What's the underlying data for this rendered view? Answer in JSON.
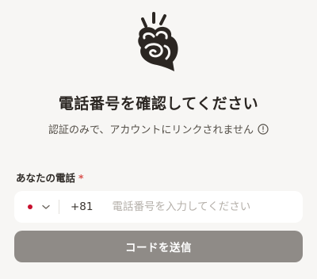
{
  "header": {
    "logo_icon": "hand-doodle-logo-icon",
    "title": "電話番号を確認してください",
    "subtitle": "認証のみで、アカウントにリンクされません",
    "info_icon": "info-circle-icon"
  },
  "form": {
    "phone_label": "あなたの電話",
    "required_mark": "*",
    "country": {
      "flag_icon": "japan-flag-icon",
      "dropdown_icon": "chevron-down-icon",
      "dial_code": "+81"
    },
    "phone_placeholder": "電話番号を入力してください",
    "phone_value": "",
    "submit_label": "コードを送信"
  },
  "colors": {
    "background": "#f7f6f4",
    "button": "#8f8b87",
    "required": "#d9534f",
    "flag_red": "#c8102e"
  }
}
